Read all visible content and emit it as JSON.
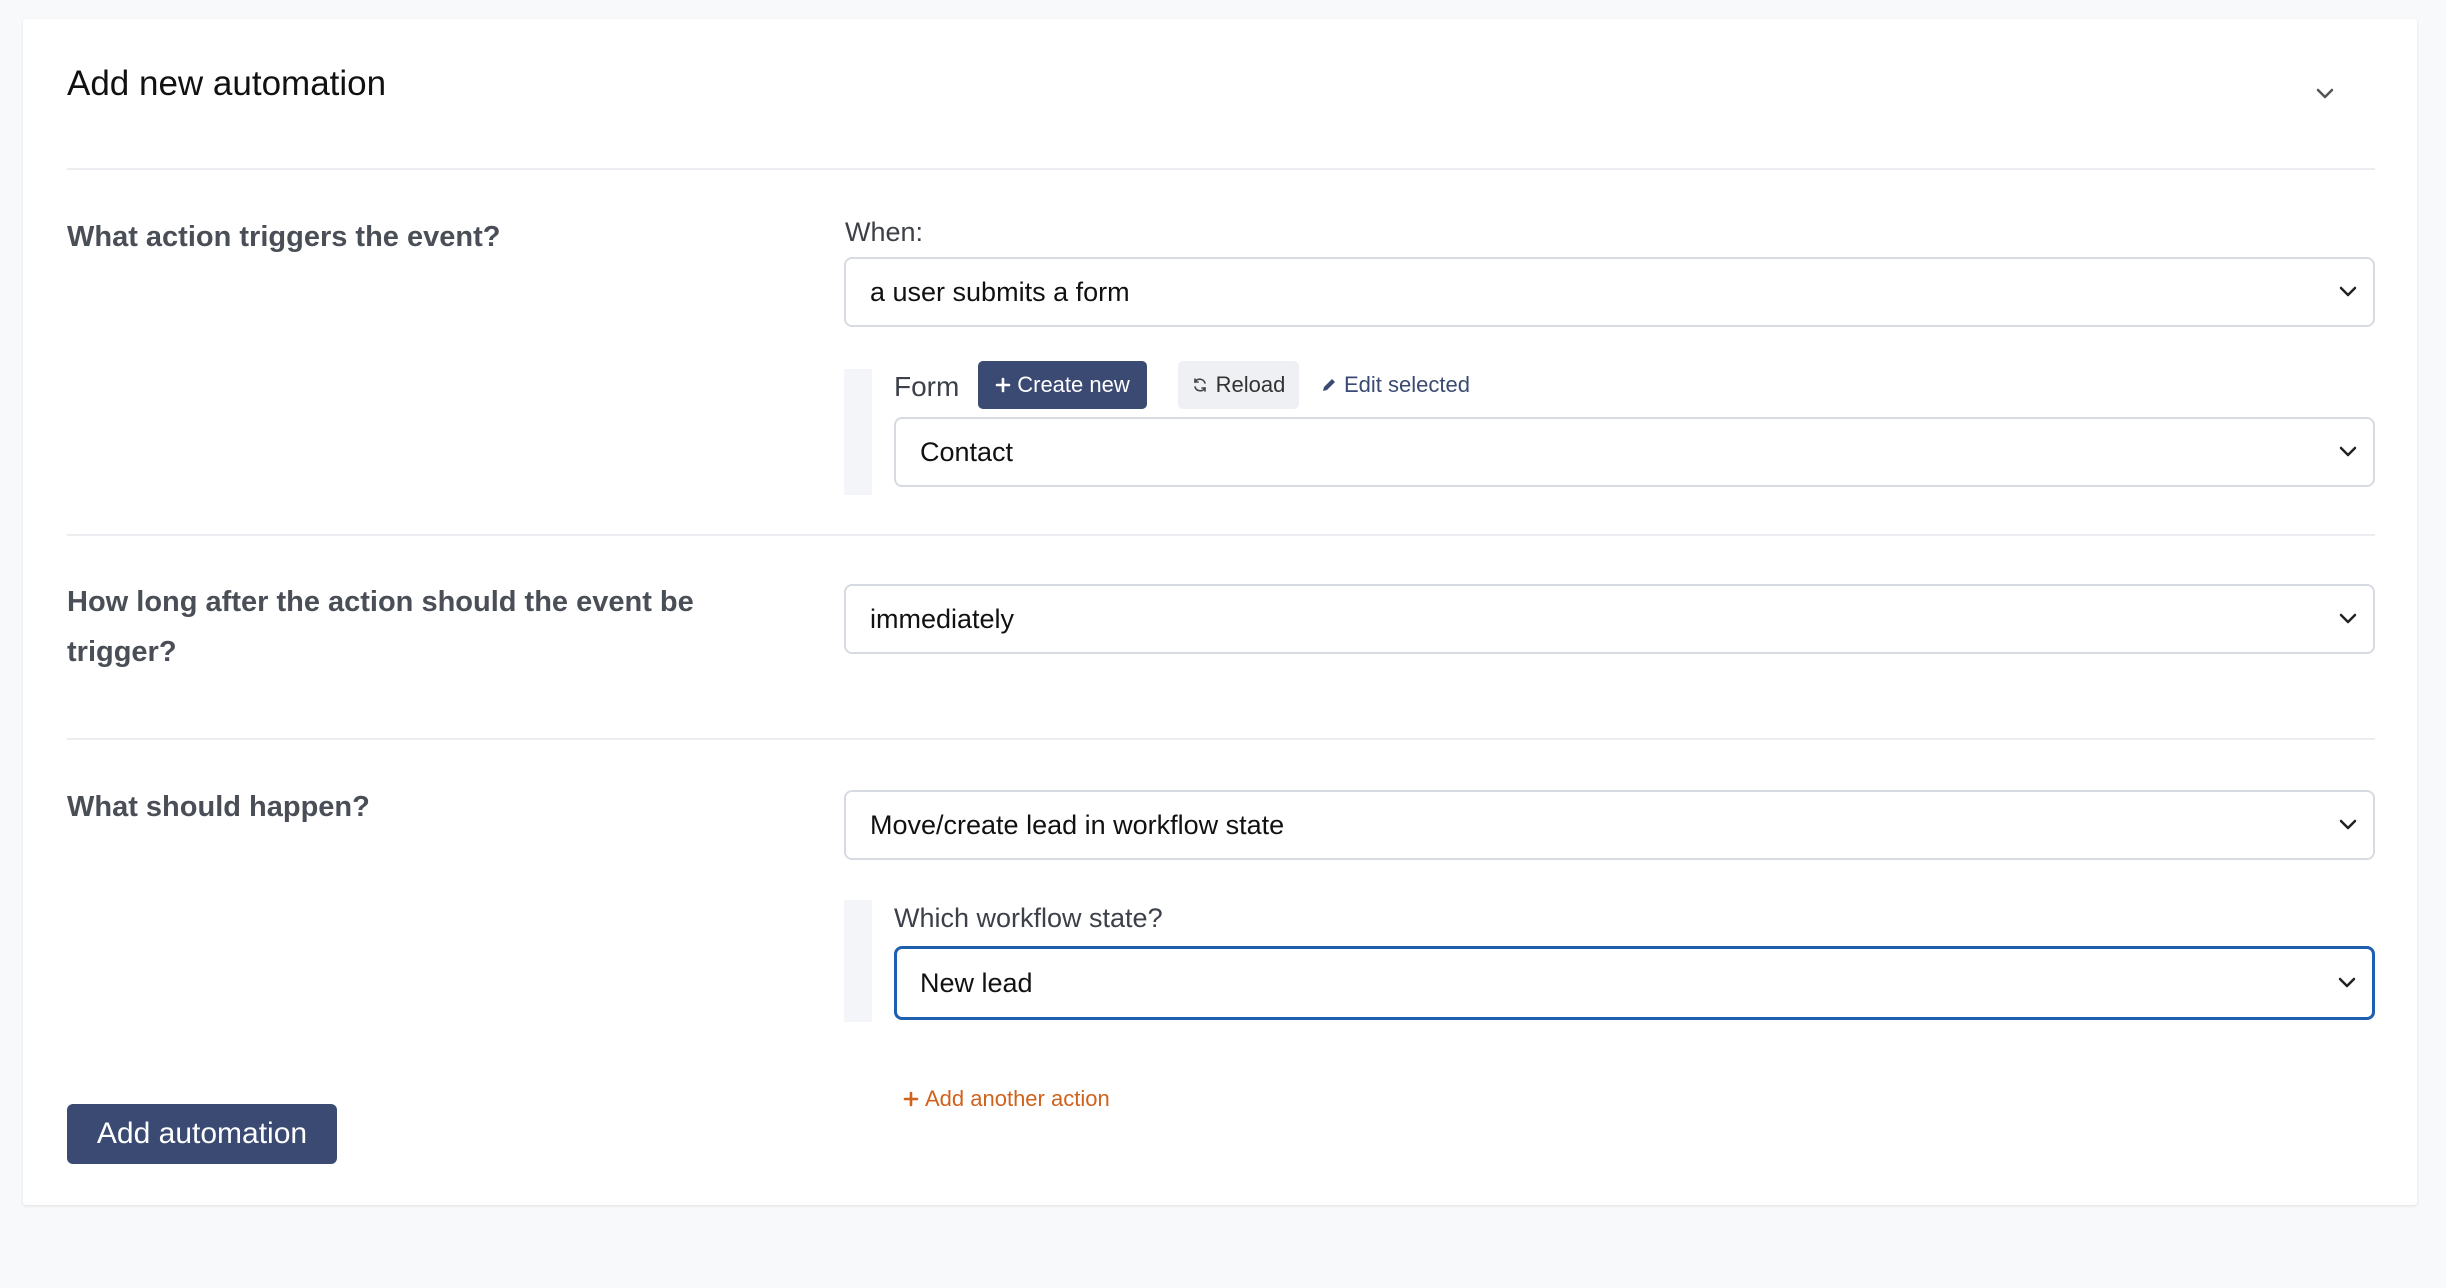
{
  "card": {
    "title": "Add new automation",
    "collapse_icon": "chevron-down-icon"
  },
  "trigger": {
    "question": "What action triggers the event?",
    "when_label": "When:",
    "when_value": "a user submits a form",
    "form_label": "Form",
    "create_new_label": "Create new",
    "reload_label": "Reload",
    "edit_selected_label": "Edit selected",
    "form_value": "Contact"
  },
  "delay": {
    "question": "How long after the action should the event be trigger?",
    "value": "immediately"
  },
  "action": {
    "question": "What should happen?",
    "value": "Move/create lead in workflow state",
    "workflow_label": "Which workflow state?",
    "workflow_value": "New lead",
    "add_another_label": "Add another action"
  },
  "submit": {
    "label": "Add automation"
  },
  "colors": {
    "primary": "#3b4a72",
    "accent_link": "#d0621c",
    "focus_border": "#1f5fb0"
  }
}
